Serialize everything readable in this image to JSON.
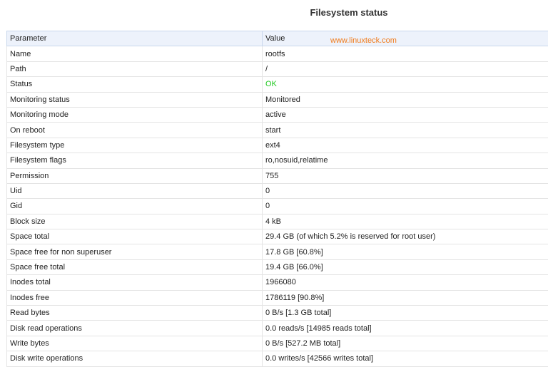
{
  "page": {
    "title": "Filesystem status",
    "watermark": "www.linuxteck.com"
  },
  "colors": {
    "header_bg": "#edf2fb",
    "ok_status": "#22c922",
    "watermark": "#f07a1a"
  },
  "table": {
    "headers": [
      "Parameter",
      "Value"
    ],
    "rows": [
      {
        "param": "Name",
        "value": "rootfs"
      },
      {
        "param": "Path",
        "value": "/"
      },
      {
        "param": "Status",
        "value": "OK"
      },
      {
        "param": "Monitoring status",
        "value": "Monitored"
      },
      {
        "param": "Monitoring mode",
        "value": "active"
      },
      {
        "param": "On reboot",
        "value": "start"
      },
      {
        "param": "Filesystem type",
        "value": "ext4"
      },
      {
        "param": "Filesystem flags",
        "value": "ro,nosuid,relatime"
      },
      {
        "param": "Permission",
        "value": "755"
      },
      {
        "param": "Uid",
        "value": "0"
      },
      {
        "param": "Gid",
        "value": "0"
      },
      {
        "param": "Block size",
        "value": "4 kB"
      },
      {
        "param": "Space total",
        "value": "29.4 GB (of which 5.2% is reserved for root user)"
      },
      {
        "param": "Space free for non superuser",
        "value": "17.8 GB [60.8%]"
      },
      {
        "param": "Space free total",
        "value": "19.4 GB [66.0%]"
      },
      {
        "param": "Inodes total",
        "value": "1966080"
      },
      {
        "param": "Inodes free",
        "value": "1786119 [90.8%]"
      },
      {
        "param": "Read bytes",
        "value": "0 B/s [1.3 GB total]"
      },
      {
        "param": "Disk read operations",
        "value": "0.0 reads/s [14985 reads total]"
      },
      {
        "param": "Write bytes",
        "value": "0 B/s [527.2 MB total]"
      },
      {
        "param": "Disk write operations",
        "value": "0.0 writes/s [42566 writes total]"
      }
    ]
  }
}
